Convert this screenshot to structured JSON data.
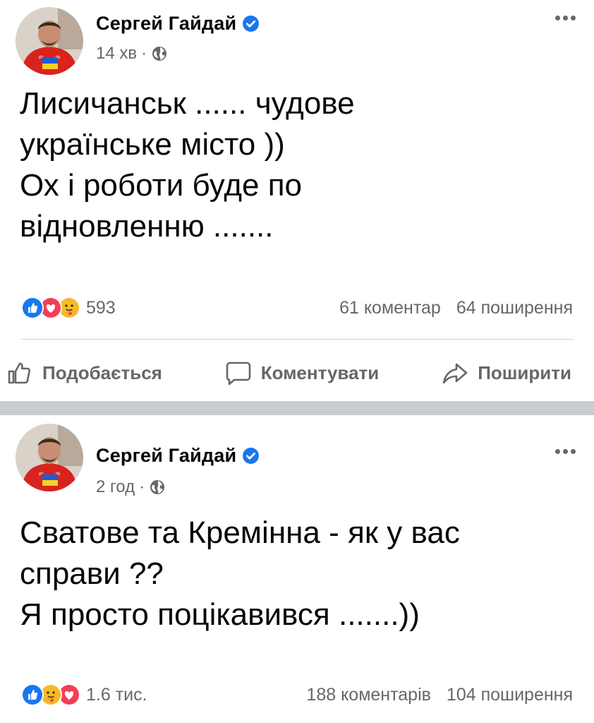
{
  "posts": [
    {
      "author": "Сергей Гайдай",
      "time": "14 хв",
      "separator": "·",
      "text": "Лисичанськ ...... чудове\nукраїнське місто ))\nОх і роботи буде по\nвідновленню .......",
      "reactions_count": "593",
      "reaction_icons": [
        "like-icon",
        "love-icon",
        "care-icon"
      ],
      "comments": "61 коментар",
      "shares": "64 поширення",
      "actions": {
        "like": "Подобається",
        "comment": "Коментувати",
        "share": "Поширити"
      }
    },
    {
      "author": "Сергей Гайдай",
      "time": "2 год",
      "separator": "·",
      "text": "Сватове та Кремінна - як у вас\nсправи ??\nЯ просто поцікавився .......))",
      "reactions_count": "1.6 тис.",
      "reaction_icons": [
        "like-icon",
        "care-icon",
        "love-icon"
      ],
      "comments": "188 коментарів",
      "shares": "104 поширення"
    }
  ],
  "colors": {
    "like": "#1877f2",
    "love": "#f33e58",
    "care": "#f7b928",
    "secondary_text": "#65676b",
    "verified": "#1877f2",
    "separator": "#c9ccd1"
  }
}
